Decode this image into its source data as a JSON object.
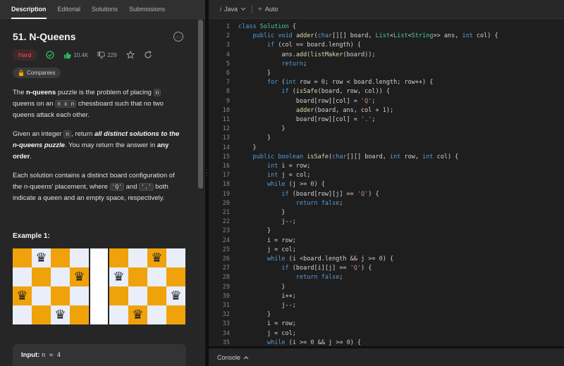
{
  "tabs": [
    "Description",
    "Editorial",
    "Solutions",
    "Submissions"
  ],
  "problem": {
    "title": "51. N-Queens",
    "difficulty": "Hard",
    "likes": "10.4K",
    "dislikes": "229",
    "companies_label": "Companies"
  },
  "description": {
    "p1": [
      "The ",
      "n-queens",
      " puzzle is the problem of placing ",
      "n",
      " queens on an ",
      "n x n",
      " chessboard such that no two queens attack each other."
    ],
    "p2": [
      "Given an integer ",
      "n",
      ", return ",
      "all distinct solutions to the ",
      "n-queens puzzle",
      ". You may return the answer in ",
      "any order",
      "."
    ],
    "p3": [
      "Each solution contains a distinct board configuration of the n-queens' placement, where ",
      "'Q'",
      " and ",
      "'.'",
      " both indicate a queen and an empty space, respectively."
    ]
  },
  "example": {
    "title": "Example 1:",
    "input_label": "Input:",
    "input_value": "n = 4",
    "boards": [
      {
        "queens": [
          [
            0,
            1
          ],
          [
            1,
            3
          ],
          [
            2,
            0
          ],
          [
            3,
            2
          ]
        ]
      },
      {
        "queens": [
          [
            0,
            2
          ],
          [
            1,
            0
          ],
          [
            2,
            3
          ],
          [
            3,
            1
          ]
        ]
      }
    ]
  },
  "editor": {
    "language": "Java",
    "mode": "Auto"
  },
  "code_lines": [
    "class Solution {",
    "    public void adder(char[][] board, List<List<String>> ans, int col) {",
    "        if (col == board.length) {",
    "            ans.add(listMaker(board));",
    "            return;",
    "        }",
    "        for (int row = 0; row < board.length; row++) {",
    "            if (isSafe(board, row, col)) {",
    "                board[row][col] = 'Q';",
    "                adder(board, ans, col + 1);",
    "                board[row][col] = '.';",
    "            }",
    "        }",
    "    }",
    "    public boolean isSafe(char[][] board, int row, int col) {",
    "        int i = row;",
    "        int j = col;",
    "        while (j >= 0) {",
    "            if (board[row][j] == 'Q') {",
    "                return false;",
    "            }",
    "            j--;",
    "        }",
    "        i = row;",
    "        j = col;",
    "        while (i <board.length && j >= 0) {",
    "            if (board[i][j] == 'Q') {",
    "                return false;",
    "            }",
    "            i++;",
    "            j--;",
    "        }",
    "        i = row;",
    "        j = col;",
    "        while (i >= 0 && j >= 0) {"
  ],
  "console": {
    "label": "Console"
  },
  "colors": {
    "keyword": "#569cd6",
    "type": "#4ec9b0",
    "string": "#ce9178",
    "method": "#dcdcaa",
    "number": "#b5cea8",
    "hard": "#ff4b5c",
    "accepted": "#2cbb5d"
  }
}
